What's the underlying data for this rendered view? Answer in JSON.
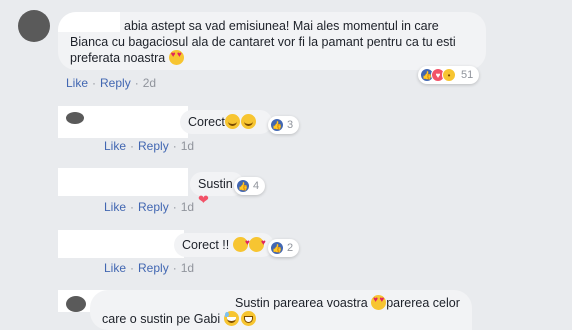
{
  "comments": [
    {
      "text_lines": [
        "abia astept sa vad emisiunea! Mai ales momentul in care",
        "Bianca cu bagaciosul ala de cantaret vor fi la pamant pentru ca tu esti",
        "preferata noastra"
      ],
      "emoji_after": "heart-eyes",
      "reaction_count": "51",
      "like_label": "Like",
      "reply_label": "Reply",
      "time": "2d"
    }
  ],
  "replies": [
    {
      "text": "Corect",
      "reaction_count": "3",
      "like_label": "Like",
      "reply_label": "Reply",
      "time": "1d"
    },
    {
      "text": "Sustin",
      "reaction_count": "4",
      "like_label": "Like",
      "reply_label": "Reply",
      "time": "1d"
    },
    {
      "text": "Corect !!",
      "reaction_count": "2",
      "like_label": "Like",
      "reply_label": "Reply",
      "time": "1d"
    },
    {
      "line1": "Sustin parearea voastra",
      "line1b": "parerea celor",
      "line2": "care o sustin pe Gabi"
    }
  ],
  "colors": {
    "link": "#4267b2",
    "muted": "#90949c",
    "bubble": "#f2f3f5",
    "background": "#e9ebee"
  }
}
